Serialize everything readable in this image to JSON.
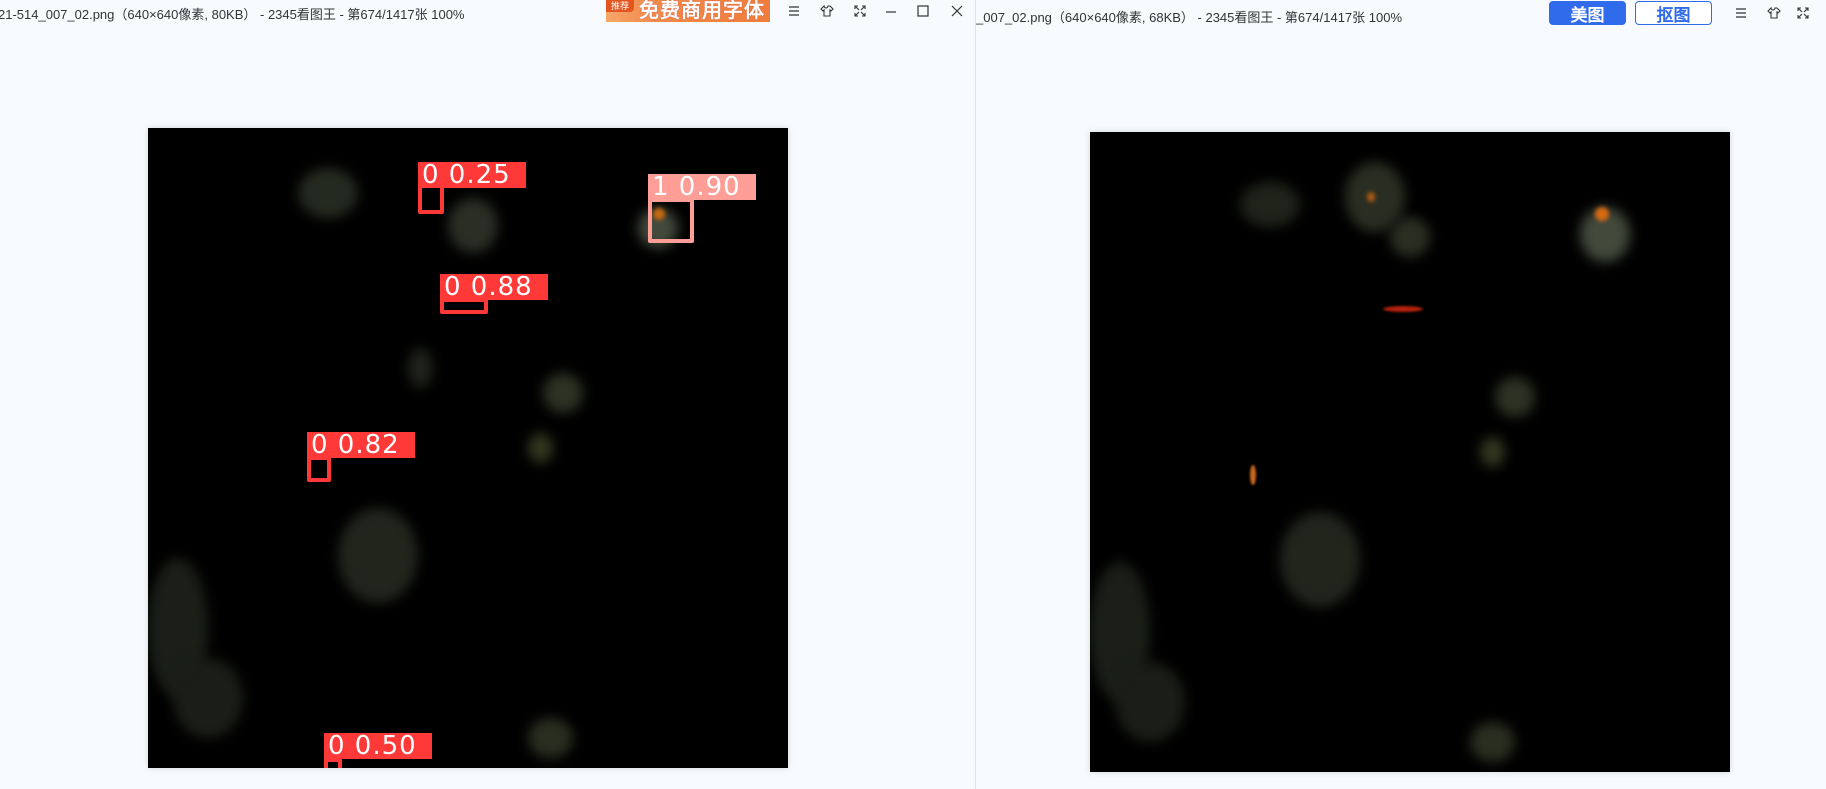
{
  "left_window": {
    "title": "21-514_007_02.png（640×640像素, 80KB） - 2345看图王 - 第674/1417张 100%",
    "ad": {
      "badge": "推荐",
      "text": "免费商用字体"
    },
    "detections": [
      {
        "label": "0 0.25",
        "class": 0
      },
      {
        "label": "1 0.90",
        "class": 1
      },
      {
        "label": "0 0.88",
        "class": 0
      },
      {
        "label": "0 0.82",
        "class": 0
      },
      {
        "label": "0 0.50",
        "class": 0
      }
    ]
  },
  "right_window": {
    "title": "_007_02.png（640×640像素, 68KB） - 2345看图王 - 第674/1417张 100%",
    "beautify_label": "美图",
    "cutout_label": "抠图"
  },
  "colors": {
    "class0": "#ff3838",
    "class1": "#ff9d97",
    "accent": "#2f6bea"
  },
  "icons": [
    "menu-icon",
    "skin-icon",
    "fullscreen-icon",
    "minimize-icon",
    "maximize-icon",
    "close-icon"
  ]
}
